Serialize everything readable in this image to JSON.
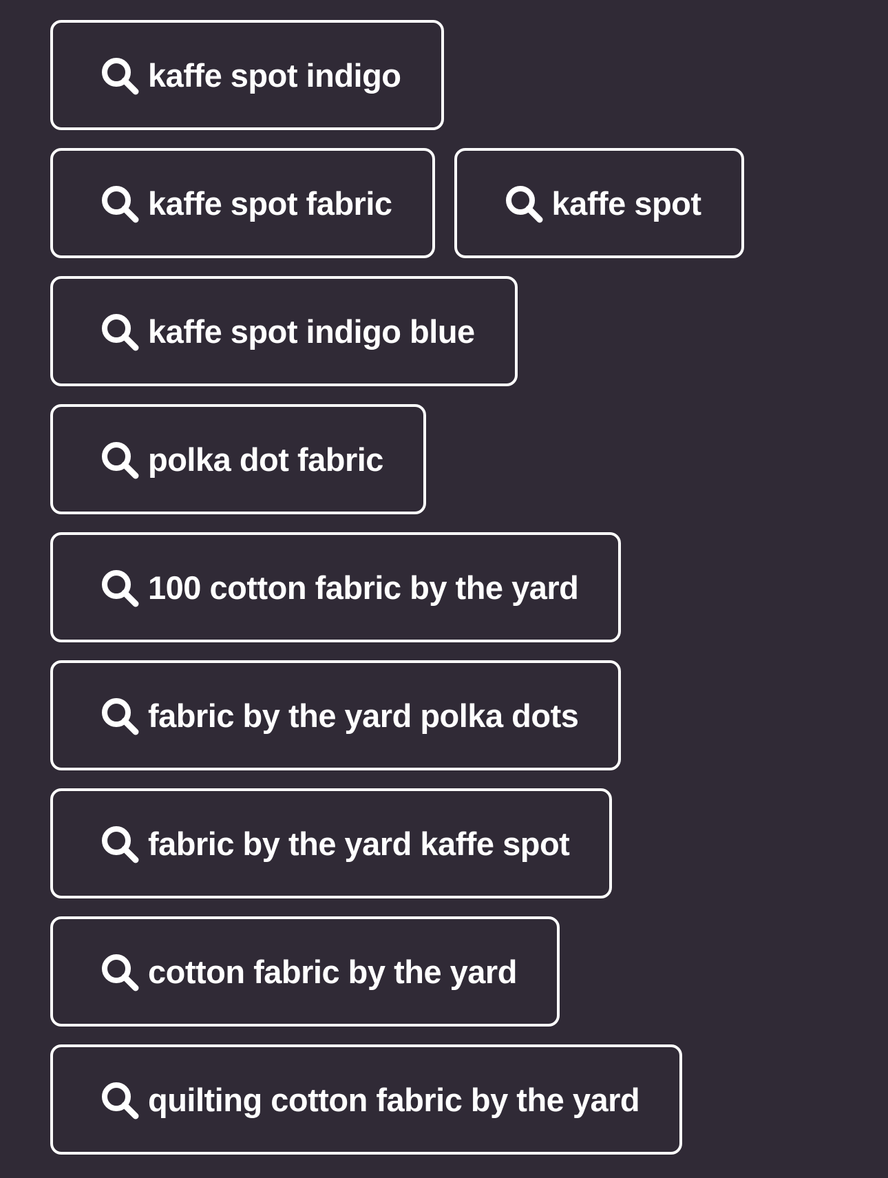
{
  "colors": {
    "background": "#302a36",
    "chip_border": "#ffffff",
    "chip_text": "#ffffff"
  },
  "search_suggestions": {
    "icon": "search-icon",
    "rows": [
      {
        "chips": [
          {
            "label": "kaffe spot indigo"
          }
        ]
      },
      {
        "chips": [
          {
            "label": "kaffe spot fabric"
          },
          {
            "label": "kaffe spot"
          }
        ]
      },
      {
        "chips": [
          {
            "label": "kaffe spot indigo blue"
          }
        ]
      },
      {
        "chips": [
          {
            "label": "polka dot fabric"
          }
        ]
      },
      {
        "chips": [
          {
            "label": "100 cotton fabric by the yard"
          }
        ]
      },
      {
        "chips": [
          {
            "label": "fabric by the yard polka dots"
          }
        ]
      },
      {
        "chips": [
          {
            "label": "fabric by the yard kaffe spot"
          }
        ]
      },
      {
        "chips": [
          {
            "label": "cotton fabric by the yard"
          }
        ]
      },
      {
        "chips": [
          {
            "label": "quilting cotton fabric by the yard"
          }
        ]
      }
    ]
  }
}
